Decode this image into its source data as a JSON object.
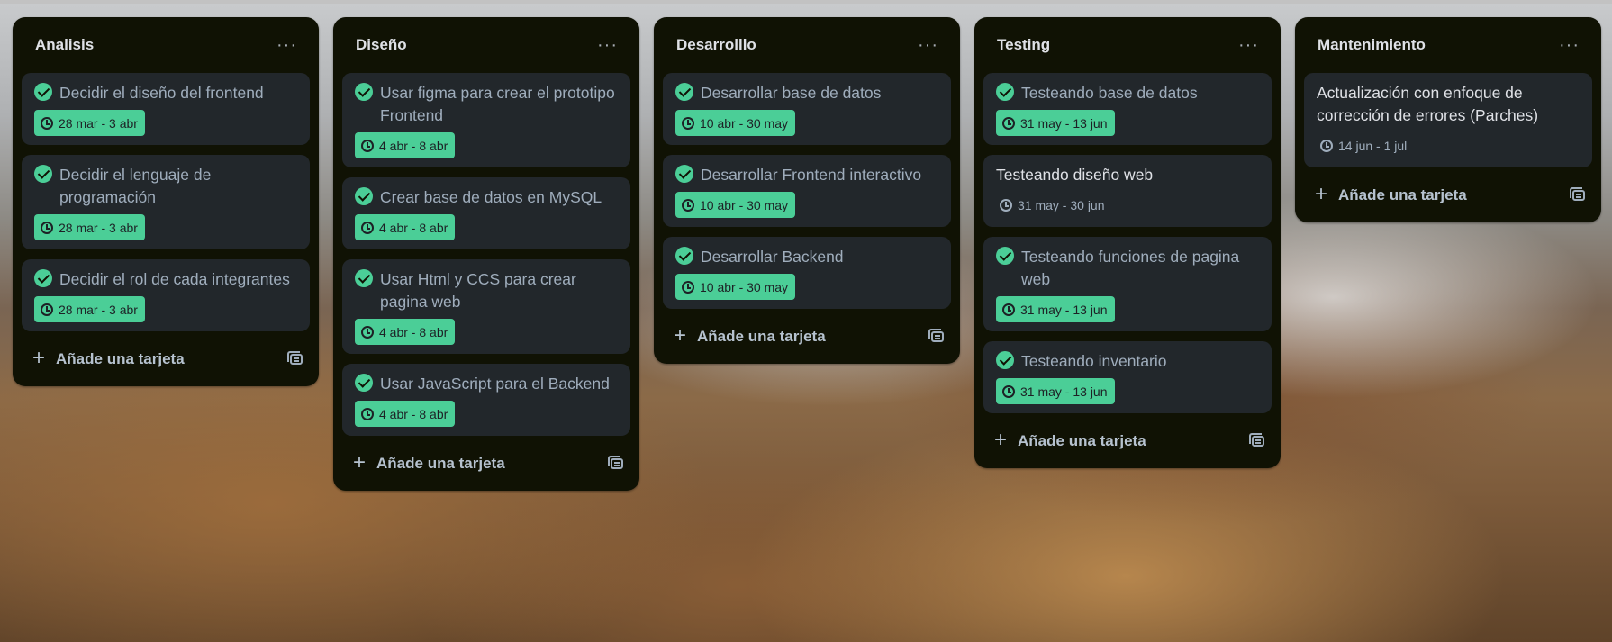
{
  "columns": [
    {
      "title": "Analisis",
      "cards": [
        {
          "title": "Decidir el diseño del frontend",
          "date": "28 mar - 3 abr",
          "complete": true
        },
        {
          "title": "Decidir el lenguaje de programación",
          "date": "28 mar - 3 abr",
          "complete": true
        },
        {
          "title": "Decidir el rol de cada integrantes",
          "date": "28 mar - 3 abr",
          "complete": true
        }
      ],
      "add_label": "Añade una tarjeta"
    },
    {
      "title": "Diseño",
      "cards": [
        {
          "title": "Usar figma para crear el prototipo Frontend",
          "date": "4 abr - 8 abr",
          "complete": true
        },
        {
          "title": "Crear base de datos en MySQL",
          "date": "4 abr - 8 abr",
          "complete": true
        },
        {
          "title": "Usar Html y CCS para crear pagina web",
          "date": "4 abr - 8 abr",
          "complete": true
        },
        {
          "title": "Usar JavaScript para el Backend",
          "date": "4 abr - 8 abr",
          "complete": true
        }
      ],
      "add_label": "Añade una tarjeta"
    },
    {
      "title": "Desarrolllo",
      "cards": [
        {
          "title": "Desarrollar base de datos",
          "date": "10 abr - 30 may",
          "complete": true
        },
        {
          "title": "Desarrollar Frontend interactivo",
          "date": "10 abr - 30 may",
          "complete": true
        },
        {
          "title": "Desarrollar Backend",
          "date": "10 abr - 30 may",
          "complete": true
        }
      ],
      "add_label": "Añade una tarjeta"
    },
    {
      "title": "Testing",
      "cards": [
        {
          "title": "Testeando base de datos",
          "date": "31 may - 13 jun",
          "complete": true
        },
        {
          "title": "Testeando diseño web",
          "date": "31 may - 30 jun",
          "complete": false
        },
        {
          "title": "Testeando funciones de pagina web",
          "date": "31 may - 13 jun",
          "complete": true
        },
        {
          "title": "Testeando inventario",
          "date": "31 may - 13 jun",
          "complete": true
        }
      ],
      "add_label": "Añade una tarjeta"
    },
    {
      "title": "Mantenimiento",
      "cards": [
        {
          "title": "Actualización con enfoque de corrección de errores (Parches)",
          "date": "14 jun - 1 jul",
          "complete": false
        }
      ],
      "add_label": "Añade una tarjeta"
    }
  ],
  "icons": {
    "complete": "check-circle-icon",
    "date": "clock-icon",
    "add": "plus-icon",
    "template": "card-template-icon",
    "menu": "more-dots-icon"
  },
  "colors": {
    "list_background": "#101204",
    "card_background": "#22272b",
    "complete_green": "#4bce97"
  }
}
